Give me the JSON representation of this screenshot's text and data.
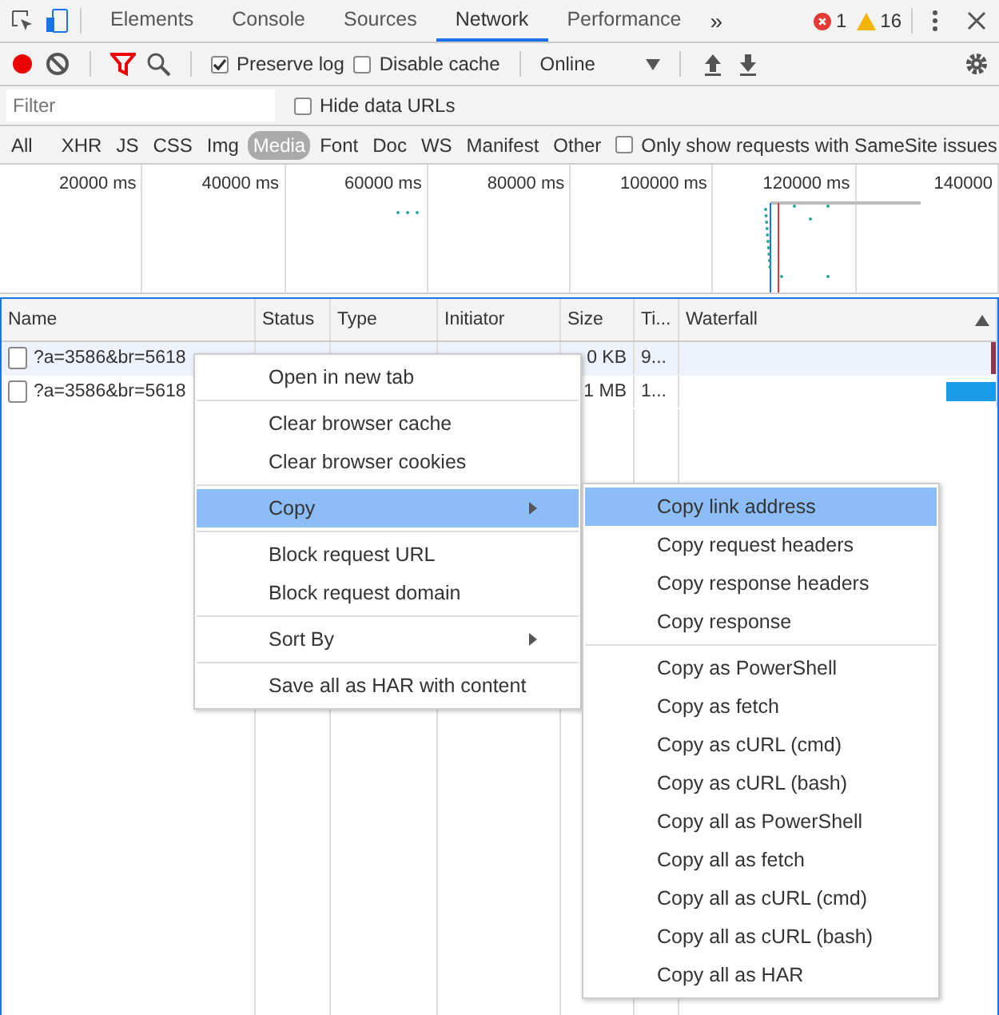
{
  "main_tabs": [
    {
      "label": "Elements",
      "selected": false
    },
    {
      "label": "Console",
      "selected": false
    },
    {
      "label": "Sources",
      "selected": false
    },
    {
      "label": "Network",
      "selected": true
    },
    {
      "label": "Performance",
      "selected": false
    }
  ],
  "more_tabs": "»",
  "errors": "1",
  "warnings": "16",
  "toolbar": {
    "recording": true,
    "preserve_log": {
      "label": "Preserve log",
      "checked": true
    },
    "disable_cache": {
      "label": "Disable cache",
      "checked": false
    },
    "throttling": "Online"
  },
  "filter": {
    "placeholder": "Filter",
    "hide_data_urls": {
      "label": "Hide data URLs",
      "checked": false
    }
  },
  "type_filters": [
    {
      "label": "All",
      "selected": false
    },
    {
      "label": "XHR",
      "selected": false
    },
    {
      "label": "JS",
      "selected": false
    },
    {
      "label": "CSS",
      "selected": false
    },
    {
      "label": "Img",
      "selected": false
    },
    {
      "label": "Media",
      "selected": true
    },
    {
      "label": "Font",
      "selected": false
    },
    {
      "label": "Doc",
      "selected": false
    },
    {
      "label": "WS",
      "selected": false
    },
    {
      "label": "Manifest",
      "selected": false
    },
    {
      "label": "Other",
      "selected": false
    }
  ],
  "samesite": {
    "label": "Only show requests with SameSite issues",
    "checked": false
  },
  "overview_ticks": [
    "20000 ms",
    "40000 ms",
    "60000 ms",
    "80000 ms",
    "100000 ms",
    "120000 ms",
    "140000"
  ],
  "table": {
    "columns": [
      "Name",
      "Status",
      "Type",
      "Initiator",
      "Size",
      "Ti...",
      "Waterfall"
    ],
    "rows": [
      {
        "name": "?a=3586&br=5618",
        "size": "0 KB",
        "time": "9...",
        "selected": true
      },
      {
        "name": "?a=3586&br=5618",
        "size": "1 MB",
        "time": "1...",
        "selected": false
      }
    ]
  },
  "context_menu": {
    "groups": [
      [
        {
          "label": "Open in new tab",
          "selected": false,
          "submenu": false
        }
      ],
      [
        {
          "label": "Clear browser cache",
          "selected": false,
          "submenu": false
        },
        {
          "label": "Clear browser cookies",
          "selected": false,
          "submenu": false
        }
      ],
      [
        {
          "label": "Copy",
          "selected": true,
          "submenu": true
        }
      ],
      [
        {
          "label": "Block request URL",
          "selected": false,
          "submenu": false
        },
        {
          "label": "Block request domain",
          "selected": false,
          "submenu": false
        }
      ],
      [
        {
          "label": "Sort By",
          "selected": false,
          "submenu": true
        }
      ],
      [
        {
          "label": "Save all as HAR with content",
          "selected": false,
          "submenu": false
        }
      ]
    ]
  },
  "copy_submenu": {
    "groups": [
      [
        {
          "label": "Copy link address",
          "selected": true
        },
        {
          "label": "Copy request headers",
          "selected": false
        },
        {
          "label": "Copy response headers",
          "selected": false
        },
        {
          "label": "Copy response",
          "selected": false
        }
      ],
      [
        {
          "label": "Copy as PowerShell",
          "selected": false
        },
        {
          "label": "Copy as fetch",
          "selected": false
        },
        {
          "label": "Copy as cURL (cmd)",
          "selected": false
        },
        {
          "label": "Copy as cURL (bash)",
          "selected": false
        },
        {
          "label": "Copy all as PowerShell",
          "selected": false
        },
        {
          "label": "Copy all as fetch",
          "selected": false
        },
        {
          "label": "Copy all as cURL (cmd)",
          "selected": false
        },
        {
          "label": "Copy all as cURL (bash)",
          "selected": false
        },
        {
          "label": "Copy all as HAR",
          "selected": false
        }
      ]
    ]
  }
}
